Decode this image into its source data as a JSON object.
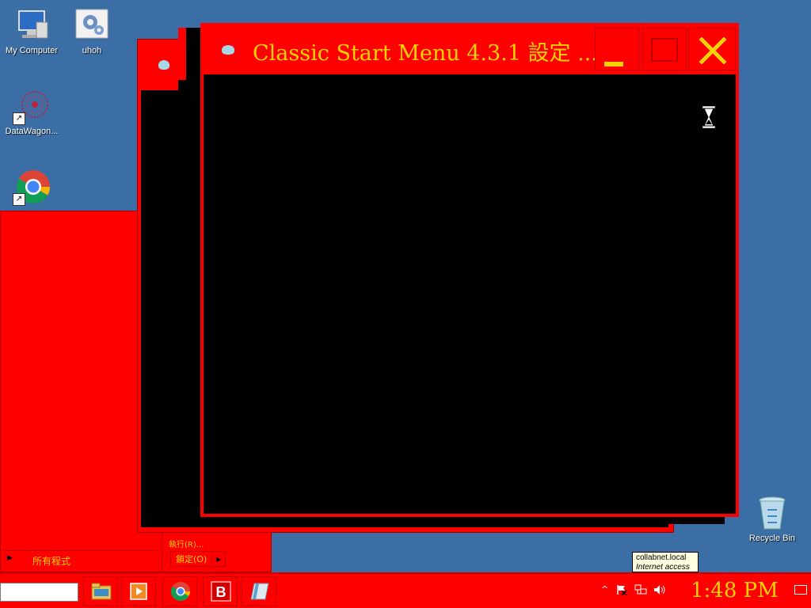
{
  "desktop": {
    "icons": [
      {
        "label": "My Computer",
        "icon": "computer-icon"
      },
      {
        "label": "uhoh",
        "icon": "gear-icon"
      },
      {
        "label": "DataWagon...",
        "icon": "datawagon-icon"
      },
      {
        "label": "",
        "icon": "chrome-icon"
      },
      {
        "label": "Recycle Bin",
        "icon": "recycle-bin-icon"
      }
    ]
  },
  "start_menu": {
    "all_programs": "所有程式",
    "shutdown_label": "鎖定(O)",
    "partial_text": "執行(R)..."
  },
  "window": {
    "title": "Classic Start Menu 4.3.1 設定 ...",
    "minimize_icon": "minimize-icon",
    "maximize_icon": "maximize-icon",
    "close_icon": "close-icon",
    "cursor": "hourglass-cursor"
  },
  "tooltip": {
    "line1": "collabnet.local",
    "line2": "Internet access"
  },
  "taskbar": {
    "search_value": "",
    "pinned": [
      "file-explorer-icon",
      "media-player-icon",
      "chrome-icon",
      "b-app-icon",
      "notes-app-icon"
    ],
    "tray_icons": [
      "show-hidden-icon",
      "action-center-icon",
      "network-icon",
      "volume-icon"
    ],
    "clock": "1:48 PM"
  },
  "colors": {
    "desktop": "#3a6ea5",
    "theme_red": "#ff0000",
    "text_yellow": "#ffd200",
    "client_black": "#000000"
  }
}
